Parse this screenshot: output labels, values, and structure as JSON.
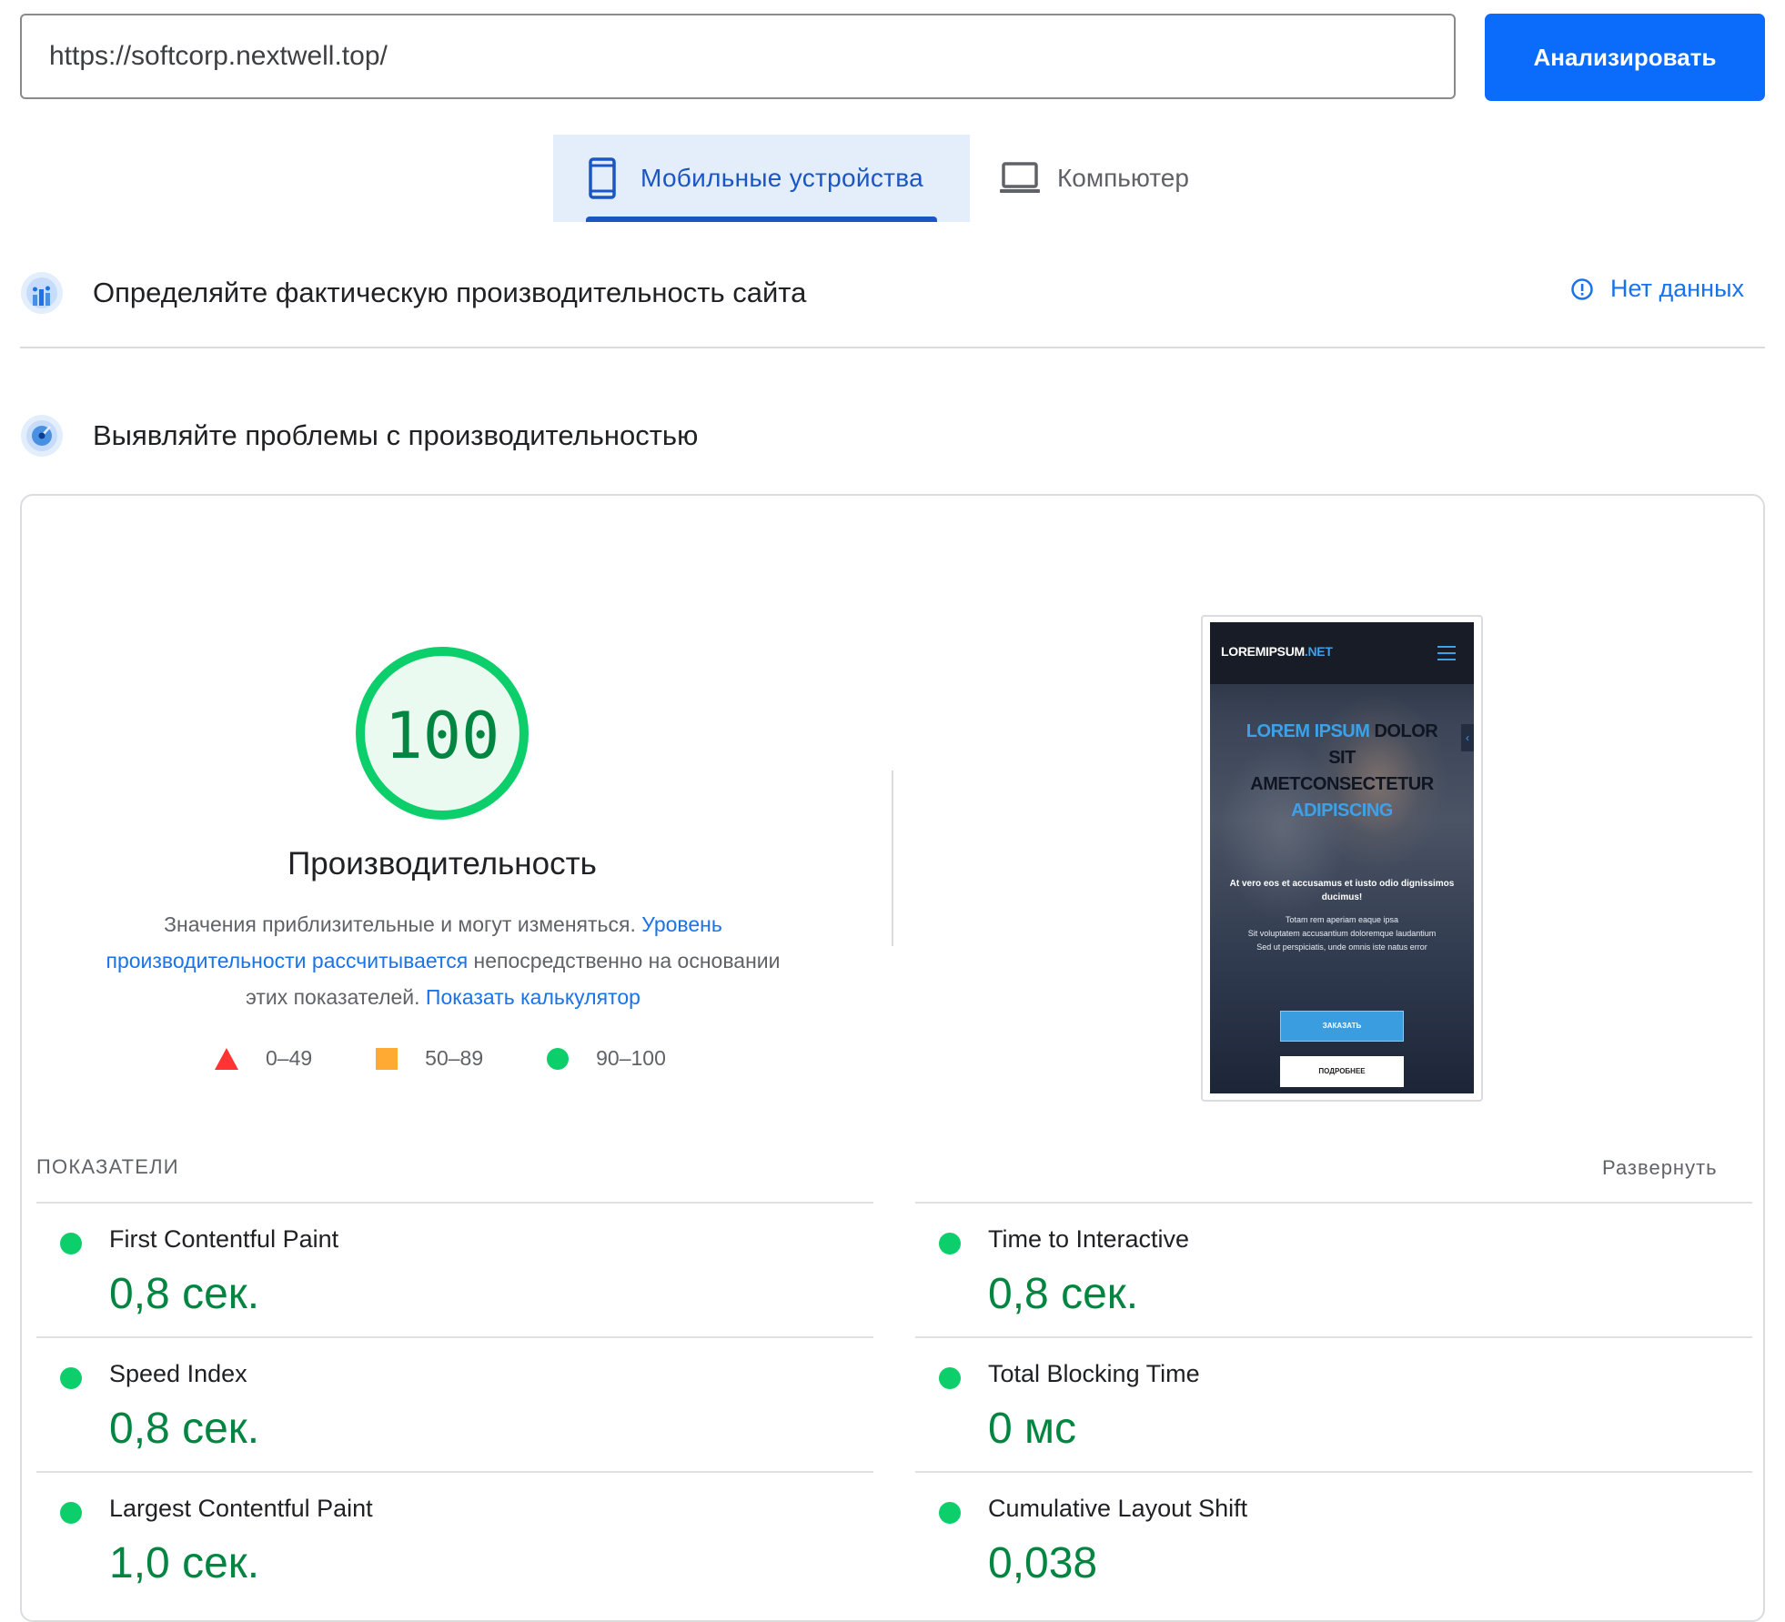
{
  "url_bar": {
    "value": "https://softcorp.nextwell.top/"
  },
  "analyze_button": {
    "label": "Анализировать"
  },
  "tabs": {
    "mobile": {
      "label": "Мобильные устройства",
      "selected": true
    },
    "desktop": {
      "label": "Компьютер",
      "selected": false
    }
  },
  "field_section": {
    "title": "Определяйте фактическую производительность сайта",
    "no_data_label": "Нет данных"
  },
  "lab_section": {
    "title": "Выявляйте проблемы с производительностью"
  },
  "performance": {
    "score": "100",
    "title": "Производительность",
    "desc_text_1": "Значения приблизительные и могут изменяться.",
    "desc_link_1": "Уровень производительности рассчитывается",
    "desc_text_2": "непосредственно на основании этих показателей.",
    "desc_link_2": "Показать калькулятор"
  },
  "legend": [
    {
      "range": "0–49",
      "color": "#ff3333",
      "shape": "triangle"
    },
    {
      "range": "50–89",
      "color": "#ffaa33",
      "shape": "square"
    },
    {
      "range": "90–100",
      "color": "#0cce6b",
      "shape": "circle"
    }
  ],
  "screenshot": {
    "logo_main": "LOREMIPSUM",
    "logo_accent": ".NET",
    "hero_blue_1": "LOREM IPSUM",
    "hero_dark_1": "DOLOR",
    "hero_dark_2": "SIT",
    "hero_dark_3": "AMETCONSECTETUR",
    "hero_blue_2": "ADIPISCING",
    "subtitle": "At vero eos et accusamus et iusto odio dignissimos ducimus!",
    "line_1": "Totam rem aperiam eaque ipsa",
    "line_2": "Sit voluptatem accusantium doloremque laudantium",
    "line_3": "Sed ut perspiciatis, unde omnis iste natus error",
    "button_order": "ЗАКАЗАТЬ",
    "button_more": "ПОДРОБНЕЕ"
  },
  "metrics": {
    "section_label": "ПОКАЗАТЕЛИ",
    "expand_label": "Развернуть",
    "items": [
      {
        "name": "First Contentful Paint",
        "value": "0,8 сек.",
        "status": "good"
      },
      {
        "name": "Time to Interactive",
        "value": "0,8 сек.",
        "status": "good"
      },
      {
        "name": "Speed Index",
        "value": "0,8 сек.",
        "status": "good"
      },
      {
        "name": "Total Blocking Time",
        "value": "0 мс",
        "status": "good"
      },
      {
        "name": "Largest Contentful Paint",
        "value": "1,0 сек.",
        "status": "good"
      },
      {
        "name": "Cumulative Layout Shift",
        "value": "0,038",
        "status": "good"
      }
    ]
  },
  "colors": {
    "accent": "#0b6bfb",
    "pass": "#0cce6b",
    "pass_text": "#018642",
    "link": "#1a73e8"
  }
}
